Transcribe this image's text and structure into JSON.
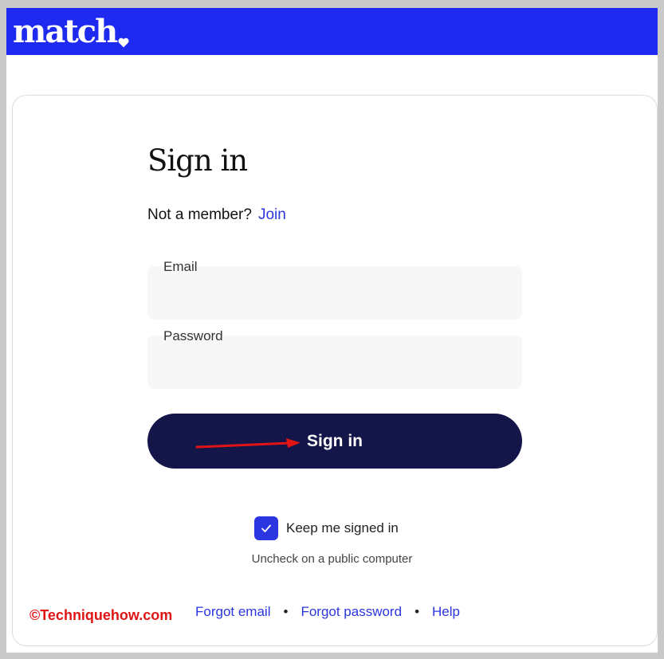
{
  "header": {
    "logo_text": "match",
    "logo_icon": "heart-icon",
    "bg_color": "#1f2af0"
  },
  "signin": {
    "title": "Sign in",
    "not_member": "Not a member?",
    "join_label": "Join",
    "email_label": "Email",
    "email_value": "",
    "password_label": "Password",
    "password_value": "",
    "button_label": "Sign in",
    "button_color": "#141548",
    "keep_label": "Keep me signed in",
    "keep_checked": true,
    "hint": "Uncheck on a public computer"
  },
  "footer": {
    "watermark": "©Techniquehow.com",
    "forgot_email": "Forgot email",
    "separator": "•",
    "forgot_password": "Forgot password",
    "help": "Help"
  },
  "annotation": {
    "arrow_color": "#e01414"
  },
  "accent_color": "#2b36e0"
}
